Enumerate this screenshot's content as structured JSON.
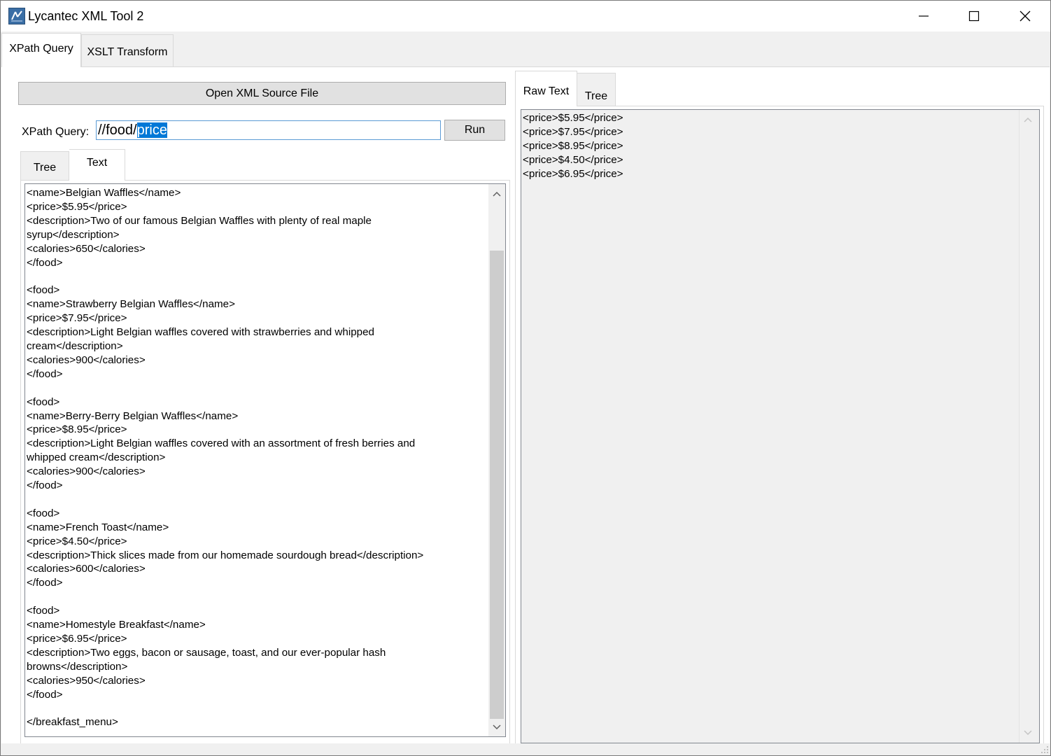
{
  "window": {
    "title": "Lycantec XML Tool 2"
  },
  "outer_tabs": [
    {
      "label": "XPath Query",
      "active": true
    },
    {
      "label": "XSLT Transform",
      "active": false
    }
  ],
  "left": {
    "open_button_label": "Open XML Source File",
    "xpath_label": "XPath Query:",
    "xpath_value_plain": "//food/",
    "xpath_value_selected": "price",
    "run_button_label": "Run",
    "tabs": [
      {
        "label": "Tree",
        "active": false
      },
      {
        "label": "Text",
        "active": true
      }
    ],
    "source_text": "<name>Belgian Waffles</name>\n<price>$5.95</price>\n<description>Two of our famous Belgian Waffles with plenty of real maple\nsyrup</description>\n<calories>650</calories>\n</food>\n\n<food>\n<name>Strawberry Belgian Waffles</name>\n<price>$7.95</price>\n<description>Light Belgian waffles covered with strawberries and whipped\ncream</description>\n<calories>900</calories>\n</food>\n\n<food>\n<name>Berry-Berry Belgian Waffles</name>\n<price>$8.95</price>\n<description>Light Belgian waffles covered with an assortment of fresh berries and\nwhipped cream</description>\n<calories>900</calories>\n</food>\n\n<food>\n<name>French Toast</name>\n<price>$4.50</price>\n<description>Thick slices made from our homemade sourdough bread</description>\n<calories>600</calories>\n</food>\n\n<food>\n<name>Homestyle Breakfast</name>\n<price>$6.95</price>\n<description>Two eggs, bacon or sausage, toast, and our ever-popular hash\nbrowns</description>\n<calories>950</calories>\n</food>\n\n</breakfast_menu>"
  },
  "right": {
    "tabs": [
      {
        "label": "Raw Text",
        "active": true
      },
      {
        "label": "Tree",
        "active": false
      }
    ],
    "result_text": "<price>$5.95</price>\n<price>$7.95</price>\n<price>$8.95</price>\n<price>$4.50</price>\n<price>$6.95</price>"
  },
  "icons": {
    "app": "app-logo-icon",
    "minimize": "minimize-icon",
    "maximize": "maximize-icon",
    "close": "close-icon",
    "scroll_up": "chevron-up-icon",
    "scroll_down": "chevron-down-icon"
  },
  "colors": {
    "selection": "#0078d7",
    "input_focus_border": "#5b9bd5",
    "button_face": "#e1e1e1",
    "window_bg": "#f0f0f0"
  }
}
